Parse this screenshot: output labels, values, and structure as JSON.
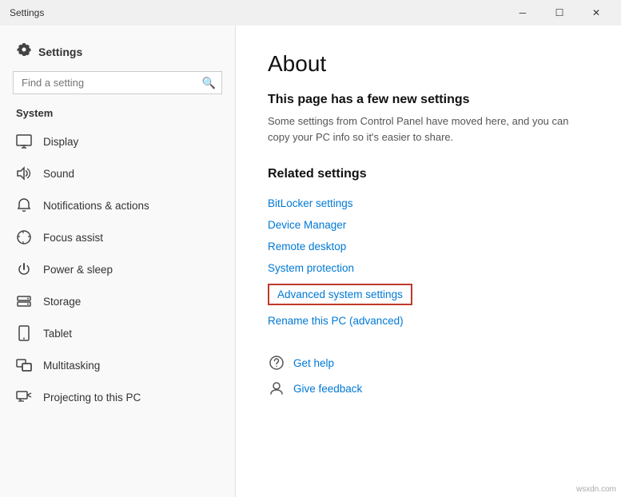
{
  "titleBar": {
    "title": "Settings",
    "minimizeLabel": "─",
    "maximizeLabel": "☐",
    "closeLabel": "✕"
  },
  "sidebar": {
    "appTitle": "Settings",
    "search": {
      "placeholder": "Find a setting",
      "iconLabel": "🔍"
    },
    "sectionLabel": "System",
    "items": [
      {
        "id": "display",
        "label": "Display",
        "icon": "display"
      },
      {
        "id": "sound",
        "label": "Sound",
        "icon": "sound"
      },
      {
        "id": "notifications",
        "label": "Notifications & actions",
        "icon": "notifications"
      },
      {
        "id": "focus",
        "label": "Focus assist",
        "icon": "focus"
      },
      {
        "id": "power",
        "label": "Power & sleep",
        "icon": "power"
      },
      {
        "id": "storage",
        "label": "Storage",
        "icon": "storage"
      },
      {
        "id": "tablet",
        "label": "Tablet",
        "icon": "tablet"
      },
      {
        "id": "multitasking",
        "label": "Multitasking",
        "icon": "multitasking"
      },
      {
        "id": "projecting",
        "label": "Projecting to this PC",
        "icon": "projecting"
      }
    ]
  },
  "content": {
    "title": "About",
    "infoHeading": "This page has a few new settings",
    "infoText": "Some settings from Control Panel have moved here, and you can copy your PC info so it's easier to share.",
    "relatedSettingsTitle": "Related settings",
    "relatedLinks": [
      {
        "id": "bitlocker",
        "label": "BitLocker settings",
        "highlighted": false
      },
      {
        "id": "device-manager",
        "label": "Device Manager",
        "highlighted": false
      },
      {
        "id": "remote-desktop",
        "label": "Remote desktop",
        "highlighted": false
      },
      {
        "id": "system-protection",
        "label": "System protection",
        "highlighted": false
      },
      {
        "id": "advanced-system",
        "label": "Advanced system settings",
        "highlighted": true
      },
      {
        "id": "rename-pc",
        "label": "Rename this PC (advanced)",
        "highlighted": false
      }
    ],
    "helpItems": [
      {
        "id": "get-help",
        "label": "Get help",
        "icon": "help"
      },
      {
        "id": "feedback",
        "label": "Give feedback",
        "icon": "feedback"
      }
    ]
  },
  "watermark": "wsxdn.com"
}
